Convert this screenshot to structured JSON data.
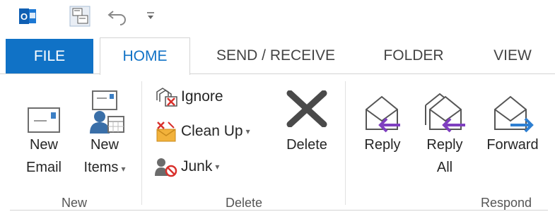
{
  "quick_access": {
    "app_icon": "outlook-app-icon",
    "send_receive_icon": "send-receive-all-folders-icon",
    "undo_icon": "undo-icon",
    "customize_icon": "customize-qat-icon"
  },
  "tabs": [
    {
      "label": "FILE"
    },
    {
      "label": "HOME"
    },
    {
      "label": "SEND / RECEIVE"
    },
    {
      "label": "FOLDER"
    },
    {
      "label": "VIEW"
    }
  ],
  "groups": {
    "new": {
      "label": "New",
      "new_email": {
        "line1": "New",
        "line2": "Email",
        "icon": "new-email-icon"
      },
      "new_items": {
        "line1": "New",
        "line2": "Items",
        "caret": "▾",
        "icon": "new-items-icon"
      }
    },
    "delete": {
      "label": "Delete",
      "ignore": {
        "label": "Ignore",
        "icon": "ignore-icon"
      },
      "clean_up": {
        "label": "Clean Up",
        "caret": "▾",
        "icon": "clean-up-icon"
      },
      "junk": {
        "label": "Junk",
        "caret": "▾",
        "icon": "junk-icon"
      },
      "delete": {
        "label": "Delete",
        "icon": "delete-x-icon"
      }
    },
    "respond": {
      "label": "Respond",
      "reply": {
        "line1": "Reply",
        "icon": "reply-icon"
      },
      "reply_all": {
        "line1": "Reply",
        "line2": "All",
        "icon": "reply-all-icon"
      },
      "forward": {
        "line1": "Forward",
        "icon": "forward-icon"
      }
    }
  },
  "colors": {
    "accent": "#1072c6",
    "reply_arrow": "#7f3fbf",
    "forward_arrow": "#2e7fd1"
  }
}
